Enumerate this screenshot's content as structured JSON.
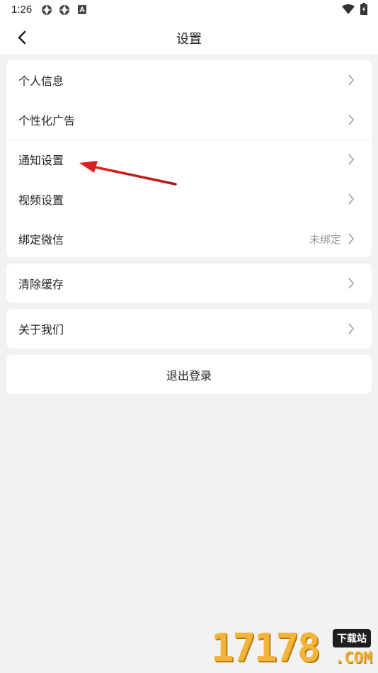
{
  "status_bar": {
    "time": "1:26",
    "left_icons": [
      "aperture-icon",
      "aperture-icon",
      "notification-a-icon"
    ],
    "right_icons": [
      "wifi-icon",
      "battery-icon"
    ]
  },
  "header": {
    "title": "设置",
    "back_icon": "chevron-left-icon"
  },
  "settings_group_1": [
    {
      "label": "个人信息",
      "value": ""
    },
    {
      "label": "个性化广告",
      "value": ""
    },
    {
      "label": "通知设置",
      "value": ""
    },
    {
      "label": "视频设置",
      "value": ""
    },
    {
      "label": "绑定微信",
      "value": "未绑定"
    }
  ],
  "settings_group_2": [
    {
      "label": "清除缓存"
    }
  ],
  "settings_group_3": [
    {
      "label": "关于我们"
    }
  ],
  "logout": {
    "label": "退出登录"
  },
  "annotation": {
    "color": "#e02020",
    "points_to": "通知设置"
  },
  "watermark": {
    "digits": "17178",
    "badge": "下载站",
    "suffix": ".COM"
  },
  "colors": {
    "background": "#f2f2f2",
    "card": "#ffffff",
    "text": "#222222",
    "muted": "#999999"
  }
}
